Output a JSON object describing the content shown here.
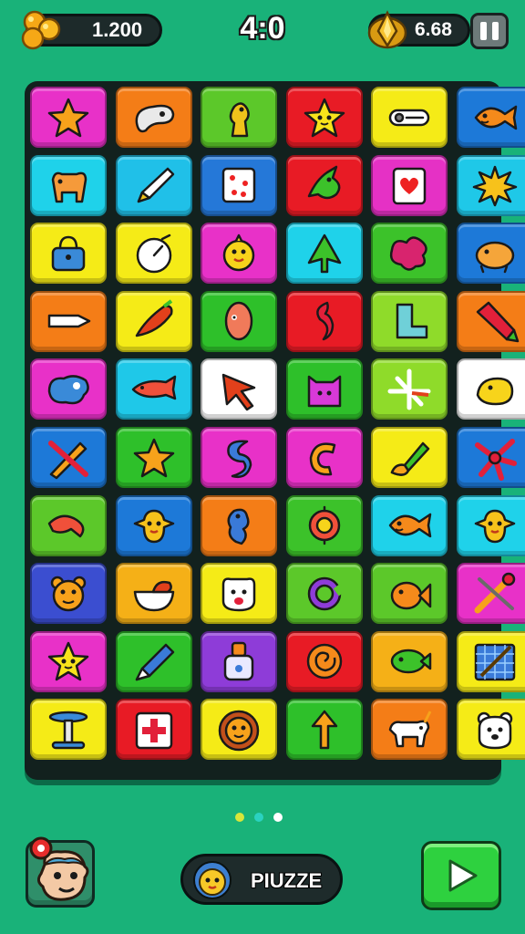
{
  "hud": {
    "coins": "1.200",
    "level": "4:0",
    "gems": "6.68"
  },
  "pager": {
    "total": 3,
    "active": 0,
    "colors": [
      "#d8e63a",
      "#2bd2c0",
      "#ffffff"
    ]
  },
  "play": {
    "label": "PIUZZE"
  },
  "board": {
    "rows": 10,
    "cols": 6,
    "tiles": [
      [
        {
          "icon": "star",
          "color": "#e831c8"
        },
        {
          "icon": "bean",
          "color": "#f47d17"
        },
        {
          "icon": "dino",
          "color": "#5cc82a"
        },
        {
          "icon": "star-face",
          "color": "#e81b25"
        },
        {
          "icon": "clip",
          "color": "#f5eb17"
        },
        {
          "icon": "fish",
          "color": "#1d79d8"
        }
      ],
      [
        {
          "icon": "dog",
          "color": "#1fd2ea"
        },
        {
          "icon": "pencil",
          "color": "#20c0e8"
        },
        {
          "icon": "dice",
          "color": "#2578d8"
        },
        {
          "icon": "bird",
          "color": "#e81b25"
        },
        {
          "icon": "heart-card",
          "color": "#e531c5"
        },
        {
          "icon": "burst",
          "color": "#1fc8e8"
        }
      ],
      [
        {
          "icon": "bag",
          "color": "#f5eb17"
        },
        {
          "icon": "clock",
          "color": "#f5eb17"
        },
        {
          "icon": "chick",
          "color": "#e831c8"
        },
        {
          "icon": "tree",
          "color": "#1fd2ea"
        },
        {
          "icon": "blob",
          "color": "#3cc22a"
        },
        {
          "icon": "pig",
          "color": "#1d79d8"
        }
      ],
      [
        {
          "icon": "chisel",
          "color": "#f47d17"
        },
        {
          "icon": "carrot",
          "color": "#f5eb17"
        },
        {
          "icon": "seed",
          "color": "#2ec02a"
        },
        {
          "icon": "swirl",
          "color": "#e81b25"
        },
        {
          "icon": "boot",
          "color": "#8fdb2a"
        },
        {
          "icon": "pen",
          "color": "#f47d17"
        }
      ],
      [
        {
          "icon": "puddle",
          "color": "#e831c8"
        },
        {
          "icon": "sub-fish",
          "color": "#1fc8e8"
        },
        {
          "icon": "arrow",
          "color": "#ffffff"
        },
        {
          "icon": "cat-box",
          "color": "#2ec02a"
        },
        {
          "icon": "windmill",
          "color": "#8fdb2a"
        },
        {
          "icon": "duck",
          "color": "#ffffff"
        }
      ],
      [
        {
          "icon": "pencils",
          "color": "#1d79d8"
        },
        {
          "icon": "star",
          "color": "#2ec02a"
        },
        {
          "icon": "s-curve",
          "color": "#e831c8"
        },
        {
          "icon": "c-curl",
          "color": "#e831c8"
        },
        {
          "icon": "brush",
          "color": "#f5eb17"
        },
        {
          "icon": "flower",
          "color": "#1d79d8"
        }
      ],
      [
        {
          "icon": "shrimp",
          "color": "#5cc82a"
        },
        {
          "icon": "bird-face",
          "color": "#1d79d8"
        },
        {
          "icon": "seahorse",
          "color": "#f47d17"
        },
        {
          "icon": "ring",
          "color": "#3cc22a"
        },
        {
          "icon": "fish",
          "color": "#1fd2ea"
        },
        {
          "icon": "bird-face",
          "color": "#1fd2ea"
        }
      ],
      [
        {
          "icon": "bear",
          "color": "#3b4ed0"
        },
        {
          "icon": "bowl",
          "color": "#f5b017"
        },
        {
          "icon": "dog-face",
          "color": "#f5eb17"
        },
        {
          "icon": "c-ring",
          "color": "#5cc82a"
        },
        {
          "icon": "goldfish",
          "color": "#5cc82a"
        },
        {
          "icon": "tools",
          "color": "#e831c8"
        }
      ],
      [
        {
          "icon": "star-face",
          "color": "#e831c8"
        },
        {
          "icon": "marker",
          "color": "#2ec02a"
        },
        {
          "icon": "bottle",
          "color": "#8e3cd8"
        },
        {
          "icon": "spiral",
          "color": "#e81b25"
        },
        {
          "icon": "green-fish",
          "color": "#f5b017"
        },
        {
          "icon": "grid-card",
          "color": "#f5eb17"
        }
      ],
      [
        {
          "icon": "stool",
          "color": "#f5eb17"
        },
        {
          "icon": "cross",
          "color": "#e81b25"
        },
        {
          "icon": "sun-face",
          "color": "#f5eb17"
        },
        {
          "icon": "up-arrow",
          "color": "#2ec02a"
        },
        {
          "icon": "unicorn",
          "color": "#f47d17"
        },
        {
          "icon": "bear-face",
          "color": "#f5eb17"
        }
      ]
    ]
  }
}
